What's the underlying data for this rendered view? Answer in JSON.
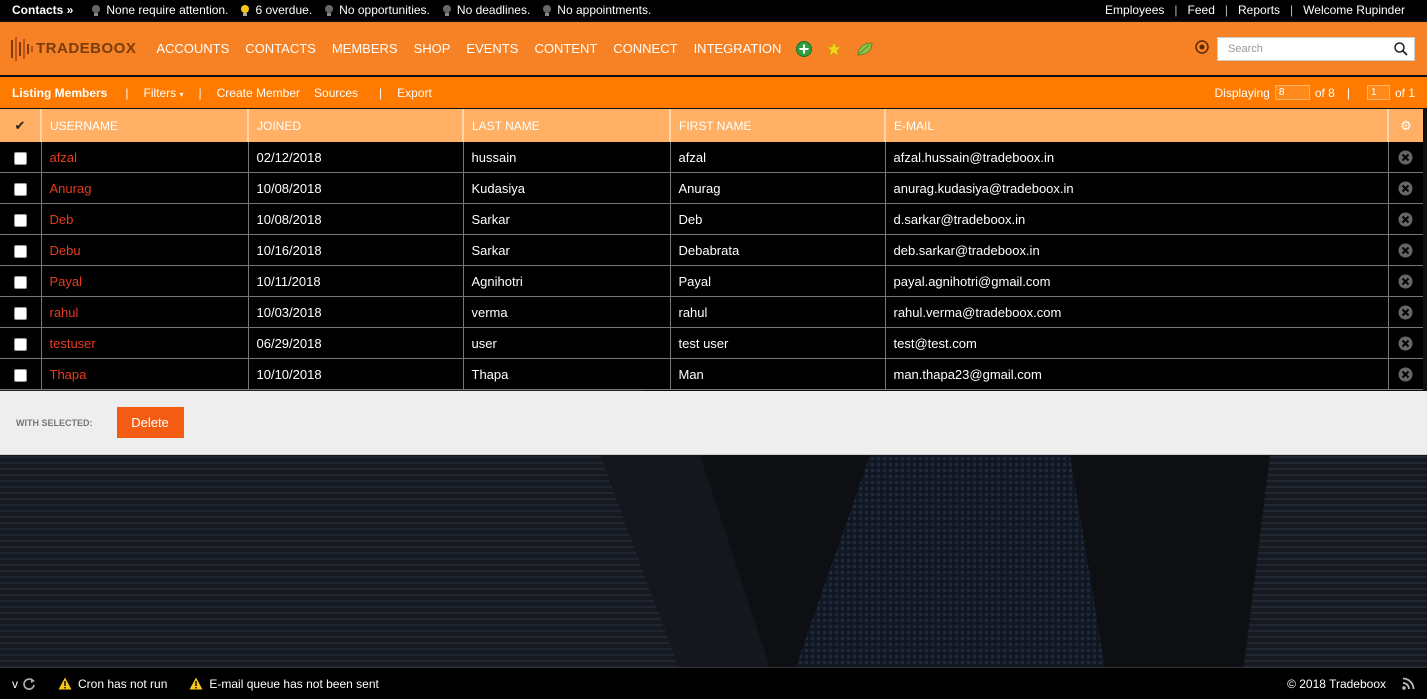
{
  "topbar": {
    "crumb": "Contacts »",
    "stats": [
      "None require attention.",
      "6 overdue.",
      "No opportunities.",
      "No deadlines.",
      "No appointments."
    ],
    "links": [
      "Employees",
      "Feed",
      "Reports",
      "Welcome Rupinder"
    ]
  },
  "nav": {
    "logo": "TRADEBOOX",
    "items": [
      "ACCOUNTS",
      "CONTACTS",
      "MEMBERS",
      "SHOP",
      "EVENTS",
      "CONTENT",
      "CONNECT",
      "INTEGRATION"
    ],
    "search_placeholder": "Search"
  },
  "subbar": {
    "title": "Listing Members",
    "filters": "Filters",
    "create": "Create Member",
    "sources": "Sources",
    "export": "Export",
    "displaying": "Displaying",
    "per_page": "8",
    "of_total": "of 8",
    "page": "1",
    "of_pages": "of 1"
  },
  "table": {
    "columns": [
      "USERNAME",
      "JOINED",
      "LAST NAME",
      "FIRST NAME",
      "E-MAIL"
    ],
    "rows": [
      {
        "username": "afzal",
        "joined": "02/12/2018",
        "last": "hussain",
        "first": "afzal",
        "email": "afzal.hussain@tradeboox.in"
      },
      {
        "username": "Anurag",
        "joined": "10/08/2018",
        "last": "Kudasiya",
        "first": "Anurag",
        "email": "anurag.kudasiya@tradeboox.in"
      },
      {
        "username": "Deb",
        "joined": "10/08/2018",
        "last": "Sarkar",
        "first": "Deb",
        "email": "d.sarkar@tradeboox.in"
      },
      {
        "username": "Debu",
        "joined": "10/16/2018",
        "last": "Sarkar",
        "first": "Debabrata",
        "email": "deb.sarkar@tradeboox.in"
      },
      {
        "username": "Payal",
        "joined": "10/11/2018",
        "last": "Agnihotri",
        "first": "Payal",
        "email": "payal.agnihotri@gmail.com"
      },
      {
        "username": "rahul",
        "joined": "10/03/2018",
        "last": "verma",
        "first": "rahul",
        "email": "rahul.verma@tradeboox.com"
      },
      {
        "username": "testuser",
        "joined": "06/29/2018",
        "last": "user",
        "first": "test user",
        "email": "test@test.com"
      },
      {
        "username": "Thapa",
        "joined": "10/10/2018",
        "last": "Thapa",
        "first": "Man",
        "email": "man.thapa23@gmail.com"
      }
    ]
  },
  "bulk": {
    "label": "WITH SELECTED:",
    "delete": "Delete"
  },
  "footer": {
    "version": "v",
    "warnings": [
      "Cron has not run",
      "E-mail queue has not been sent"
    ],
    "copyright": "© 2018 Tradeboox"
  },
  "colors": {
    "nav_orange": "#f78226",
    "subbar_orange": "#ff7a00",
    "header_peach": "#ffb065",
    "username_red": "#e63b1f",
    "delete_button": "#f35c12"
  },
  "icons": {
    "stats": [
      "bulb-icon",
      "bulb-lit-icon",
      "bulb-icon",
      "bulb-icon",
      "bulb-icon"
    ],
    "nav": [
      "add-icon",
      "star-icon",
      "leaf-icon"
    ],
    "settings": "gear-icon",
    "row_action": "remove-icon",
    "rss": "rss-icon"
  }
}
